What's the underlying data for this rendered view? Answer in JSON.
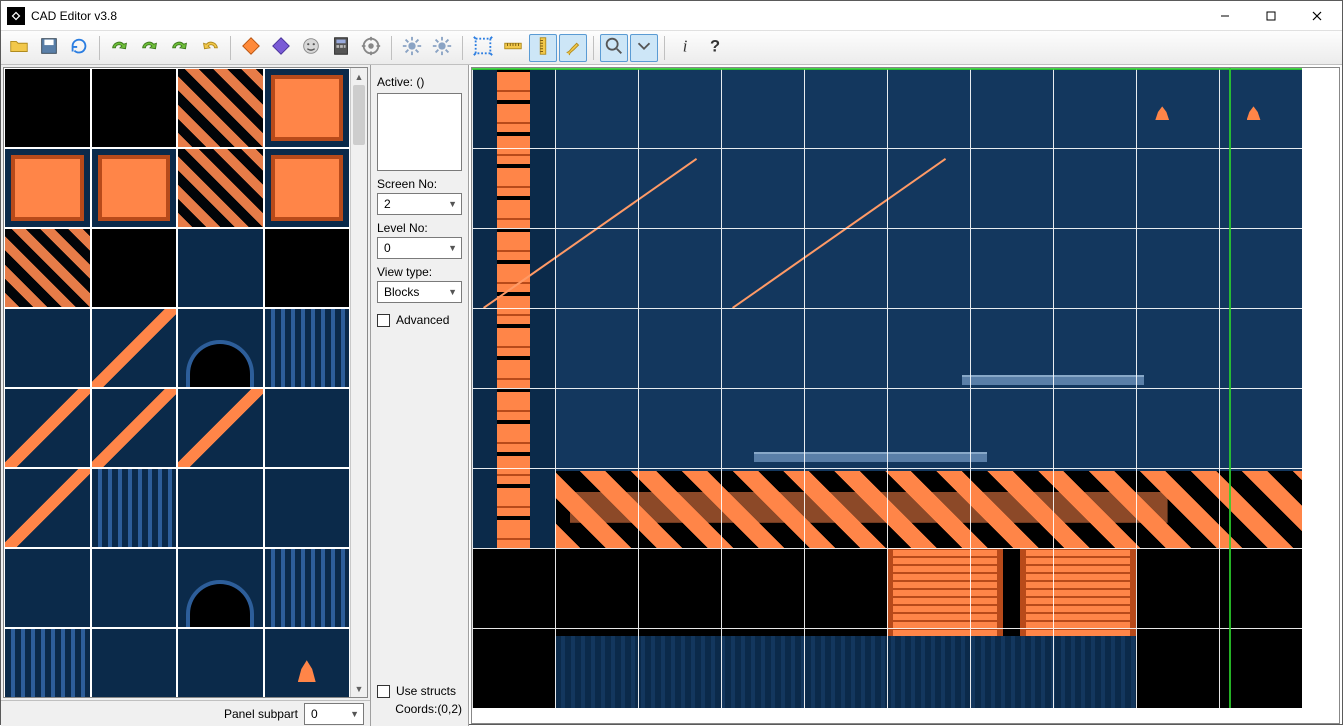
{
  "window": {
    "title": "CAD Editor v3.8"
  },
  "toolbar": {
    "icons": [
      "open-icon",
      "save-icon",
      "refresh-icon",
      "|",
      "redo-1-icon",
      "redo-2-icon",
      "redo-3-icon",
      "undo-icon",
      "|",
      "diamond-orange-icon",
      "diamond-purple-icon",
      "smiley-icon",
      "calculator-icon",
      "target-icon",
      "|",
      "gear-icon",
      "gear2-icon",
      "|",
      "select-all-icon",
      "ruler-icon",
      "ruler-vert-icon",
      "brush-icon",
      "|",
      "zoom-icon",
      "zoom-dropdown-icon",
      "|",
      "info-icon",
      "help-icon"
    ],
    "active_group_start": 16,
    "active_group_end": 19
  },
  "left_footer": {
    "label": "Panel subpart",
    "value": "0"
  },
  "props": {
    "active_label": "Active: ()",
    "screen_label": "Screen No:",
    "screen_value": "2",
    "level_label": "Level No:",
    "level_value": "0",
    "view_label": "View type:",
    "view_value": "Blocks",
    "advanced_label": "Advanced",
    "use_structs_label": "Use structs",
    "coords_label": "Coords:(0,2)"
  },
  "palette": {
    "rows": 8,
    "cols": 4,
    "tiles": [
      "black",
      "black",
      "haz",
      "panel",
      "panel",
      "panel",
      "haz",
      "panel",
      "haz",
      "black",
      "navy",
      "black",
      "navy",
      "diag",
      "dome",
      "bars",
      "diag",
      "diag",
      "diag",
      "navy",
      "diag",
      "bars",
      "navy",
      "navy",
      "navy",
      "navy",
      "dome",
      "bars",
      "bars",
      "navy",
      "navy",
      "flame"
    ]
  },
  "canvas": {
    "grid_cols": 10,
    "grid_rows": 8
  }
}
